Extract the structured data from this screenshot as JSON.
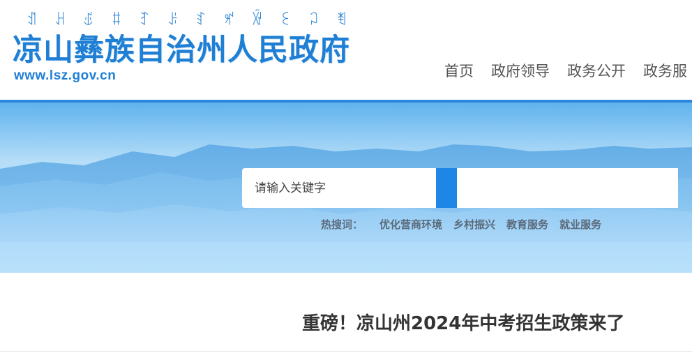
{
  "header": {
    "yi_script": [
      "ꀊ",
      "ꃅ",
      "ꍑ",
      "ꐚ",
      "ꆈ",
      "ꌠ",
      "ꆏ",
      "ꈪ",
      "ꑞ",
      "ꏂ",
      "ꃀ",
      "ꄮ"
    ],
    "title": "凉山彝族自治州人民政府",
    "url": "www.lsz.gov.cn"
  },
  "nav": {
    "items": [
      "首页",
      "政府领导",
      "政务公开",
      "政务服"
    ]
  },
  "search": {
    "placeholder": "请输入关键字",
    "value": ""
  },
  "hot_search": {
    "label": "热搜词：",
    "items": [
      "优化营商环境",
      "乡村振兴",
      "教育服务",
      "就业服务"
    ]
  },
  "article": {
    "title": "重磅！凉山州2024年中考招生政策来了"
  },
  "colors": {
    "brand_blue": "#1f7fd4",
    "banner_sky": "#8ecbf5",
    "search_button": "#1e87e5"
  }
}
